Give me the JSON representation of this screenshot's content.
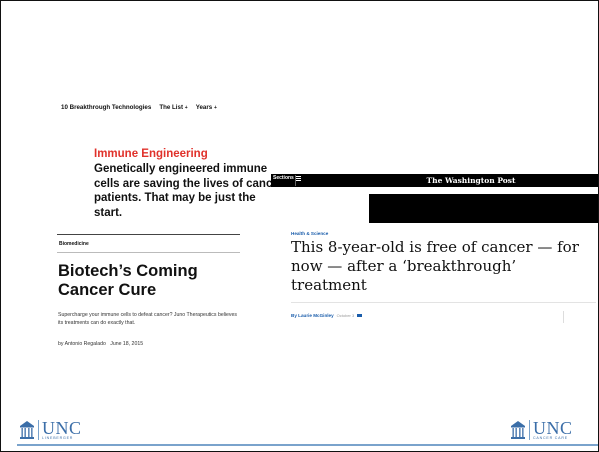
{
  "mit": {
    "nav": {
      "item1": "10 Breakthrough Technologies",
      "item2": "The List",
      "item2_arrow": "+",
      "item3": "Years",
      "item3_arrow": "+"
    },
    "kicker": "Immune Engineering",
    "dek": "Genetically engineered immune cells are saving the lives of cancer patients. That may be just the start.",
    "category": "Biomedicine",
    "headline": "Biotech’s Coming Cancer Cure",
    "summary": "Supercharge your immune cells to defeat cancer? Juno Therapeutics believes its treatments can do exactly that.",
    "author": "by Antonio Regalado",
    "date": "June 18, 2015"
  },
  "wapo": {
    "sections_label": "Sections",
    "logo": "The Washington Post",
    "section_label": "Health & Science",
    "headline": "This 8-year-old is free of cancer — for now — after a ‘breakthrough’ treatment",
    "byline_prefix": "By",
    "author": "Laurie McGinley",
    "date": "October 3"
  },
  "footer": {
    "left_brand": "UNC",
    "left_sub": "LINEBERGER",
    "right_brand": "UNC",
    "right_sub": "CANCER CARE",
    "accent": "#3b6ea8"
  }
}
